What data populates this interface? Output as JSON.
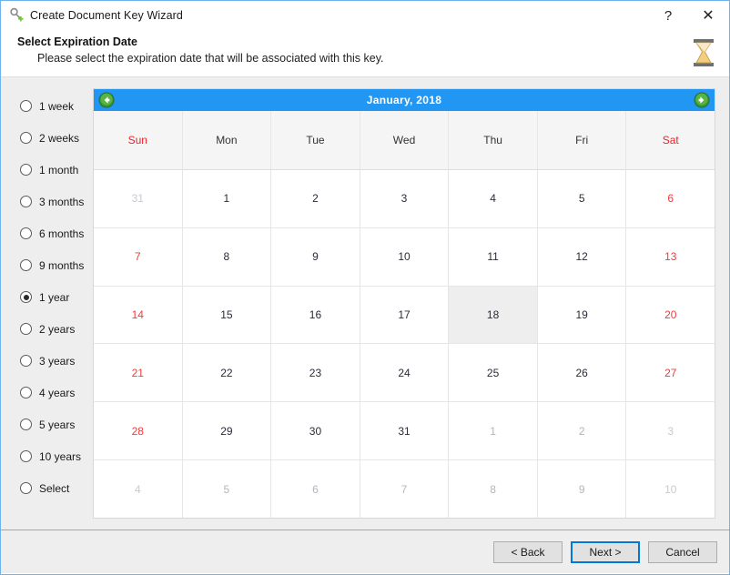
{
  "window": {
    "title": "Create Document Key Wizard",
    "icon": "key-add-icon",
    "help_label": "?",
    "close_label": "✕"
  },
  "header": {
    "title": "Select Expiration Date",
    "subtitle": "Please select the expiration date that will be associated with this key.",
    "icon": "hourglass-icon"
  },
  "options": {
    "selected": "1 year",
    "items": [
      {
        "label": "1 week"
      },
      {
        "label": "2 weeks"
      },
      {
        "label": "1 month"
      },
      {
        "label": "3 months"
      },
      {
        "label": "6 months"
      },
      {
        "label": "9 months"
      },
      {
        "label": "1 year"
      },
      {
        "label": "2 years"
      },
      {
        "label": "3 years"
      },
      {
        "label": "4 years"
      },
      {
        "label": "5 years"
      },
      {
        "label": "10 years"
      },
      {
        "label": "Select"
      }
    ]
  },
  "calendar": {
    "month_label": "January,  2018",
    "prev_icon": "arrow-left-circle-icon",
    "next_icon": "arrow-right-circle-icon",
    "accent_color": "#2196f3",
    "weekend_color": "#e8262a",
    "daynames": [
      {
        "label": "Sun",
        "weekend": true
      },
      {
        "label": "Mon",
        "weekend": false
      },
      {
        "label": "Tue",
        "weekend": false
      },
      {
        "label": "Wed",
        "weekend": false
      },
      {
        "label": "Thu",
        "weekend": false
      },
      {
        "label": "Fri",
        "weekend": false
      },
      {
        "label": "Sat",
        "weekend": true
      }
    ],
    "selected_day": 18,
    "weeks": [
      [
        {
          "day": "31",
          "other": true,
          "weekend": true,
          "highlight": false
        },
        {
          "day": "1",
          "other": false,
          "weekend": false,
          "highlight": false
        },
        {
          "day": "2",
          "other": false,
          "weekend": false,
          "highlight": false
        },
        {
          "day": "3",
          "other": false,
          "weekend": false,
          "highlight": false
        },
        {
          "day": "4",
          "other": false,
          "weekend": false,
          "highlight": false
        },
        {
          "day": "5",
          "other": false,
          "weekend": false,
          "highlight": false
        },
        {
          "day": "6",
          "other": false,
          "weekend": true,
          "highlight": false
        }
      ],
      [
        {
          "day": "7",
          "other": false,
          "weekend": true,
          "highlight": false
        },
        {
          "day": "8",
          "other": false,
          "weekend": false,
          "highlight": false
        },
        {
          "day": "9",
          "other": false,
          "weekend": false,
          "highlight": false
        },
        {
          "day": "10",
          "other": false,
          "weekend": false,
          "highlight": false
        },
        {
          "day": "11",
          "other": false,
          "weekend": false,
          "highlight": false
        },
        {
          "day": "12",
          "other": false,
          "weekend": false,
          "highlight": false
        },
        {
          "day": "13",
          "other": false,
          "weekend": true,
          "highlight": false
        }
      ],
      [
        {
          "day": "14",
          "other": false,
          "weekend": true,
          "highlight": false
        },
        {
          "day": "15",
          "other": false,
          "weekend": false,
          "highlight": false
        },
        {
          "day": "16",
          "other": false,
          "weekend": false,
          "highlight": false
        },
        {
          "day": "17",
          "other": false,
          "weekend": false,
          "highlight": false
        },
        {
          "day": "18",
          "other": false,
          "weekend": false,
          "highlight": true
        },
        {
          "day": "19",
          "other": false,
          "weekend": false,
          "highlight": false
        },
        {
          "day": "20",
          "other": false,
          "weekend": true,
          "highlight": false
        }
      ],
      [
        {
          "day": "21",
          "other": false,
          "weekend": true,
          "highlight": false
        },
        {
          "day": "22",
          "other": false,
          "weekend": false,
          "highlight": false
        },
        {
          "day": "23",
          "other": false,
          "weekend": false,
          "highlight": false
        },
        {
          "day": "24",
          "other": false,
          "weekend": false,
          "highlight": false
        },
        {
          "day": "25",
          "other": false,
          "weekend": false,
          "highlight": false
        },
        {
          "day": "26",
          "other": false,
          "weekend": false,
          "highlight": false
        },
        {
          "day": "27",
          "other": false,
          "weekend": true,
          "highlight": false
        }
      ],
      [
        {
          "day": "28",
          "other": false,
          "weekend": true,
          "highlight": false
        },
        {
          "day": "29",
          "other": false,
          "weekend": false,
          "highlight": false
        },
        {
          "day": "30",
          "other": false,
          "weekend": false,
          "highlight": false
        },
        {
          "day": "31",
          "other": false,
          "weekend": false,
          "highlight": false
        },
        {
          "day": "1",
          "other": true,
          "weekend": false,
          "highlight": false
        },
        {
          "day": "2",
          "other": true,
          "weekend": false,
          "highlight": false
        },
        {
          "day": "3",
          "other": true,
          "weekend": true,
          "highlight": false
        }
      ],
      [
        {
          "day": "4",
          "other": true,
          "weekend": true,
          "highlight": false
        },
        {
          "day": "5",
          "other": true,
          "weekend": false,
          "highlight": false
        },
        {
          "day": "6",
          "other": true,
          "weekend": false,
          "highlight": false
        },
        {
          "day": "7",
          "other": true,
          "weekend": false,
          "highlight": false
        },
        {
          "day": "8",
          "other": true,
          "weekend": false,
          "highlight": false
        },
        {
          "day": "9",
          "other": true,
          "weekend": false,
          "highlight": false
        },
        {
          "day": "10",
          "other": true,
          "weekend": true,
          "highlight": false
        }
      ]
    ]
  },
  "footer": {
    "back_label": "< Back",
    "next_label": "Next >",
    "cancel_label": "Cancel"
  }
}
